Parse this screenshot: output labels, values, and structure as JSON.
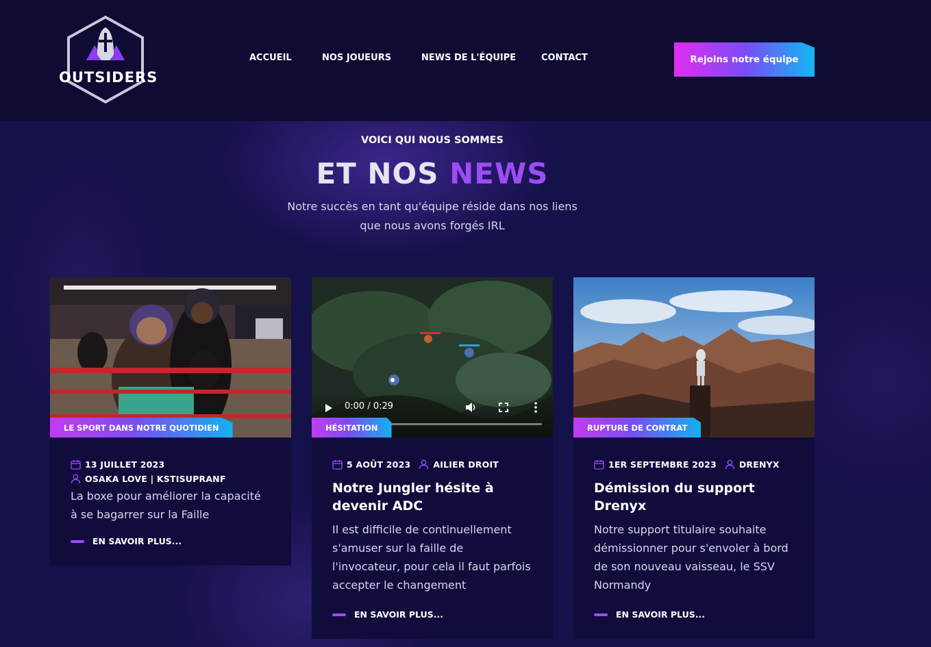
{
  "brand": {
    "name": "OUTSIDERS"
  },
  "nav": {
    "items": [
      "ACCUEIL",
      "NOS JOUEURS",
      "NEWS DE L'ÉQUIPE",
      "CONTACT"
    ],
    "cta": "Rejoins notre équipe"
  },
  "hero": {
    "eyebrow": "VOICI QUI NOUS SOMMES",
    "title_part1": "ET NOS",
    "title_part2": "NEWS",
    "intro": "Notre succès en tant qu'équipe réside dans nos liens que nous avons forgés IRL"
  },
  "cards": [
    {
      "tag": "LE SPORT DANS NOTRE QUOTIDIEN",
      "date": "13 JUILLET 2023",
      "author": "OSAKA LOVE | KSTISUPRANF",
      "title": "",
      "text": "La boxe pour améliorer la capacité à se bagarrer sur la Faille",
      "read_more": "EN SAVOIR PLUS..."
    },
    {
      "tag": "HÉSITATION",
      "date": "5 AOÛT 2023",
      "author": "AILIER DROIT",
      "title": "Notre Jungler hésite à devenir ADC",
      "text": "Il est difficile de continuellement s'amuser sur la faille de l'invocateur, pour cela il faut parfois accepter le changement",
      "read_more": "EN SAVOIR PLUS...",
      "video": {
        "time": "0:00 / 0:29"
      }
    },
    {
      "tag": "RUPTURE DE CONTRAT",
      "date": "1ER SEPTEMBRE 2023",
      "author": "DRENYX",
      "title": "Démission du support Drenyx",
      "text": "Notre support titulaire souhaite démissionner pour s'envoler à bord de son nouveau vaisseau, le SSV Normandy",
      "read_more": "EN SAVOIR PLUS..."
    }
  ],
  "colors": {
    "background": "#0e0c33",
    "accent_purple": "#9d4cf7",
    "gradient_pink": "#e02ef0",
    "gradient_blue": "#12b6f2"
  },
  "icons": [
    "calendar-icon",
    "user-icon",
    "play-icon",
    "volume-icon",
    "fullscreen-icon",
    "more-icon"
  ]
}
